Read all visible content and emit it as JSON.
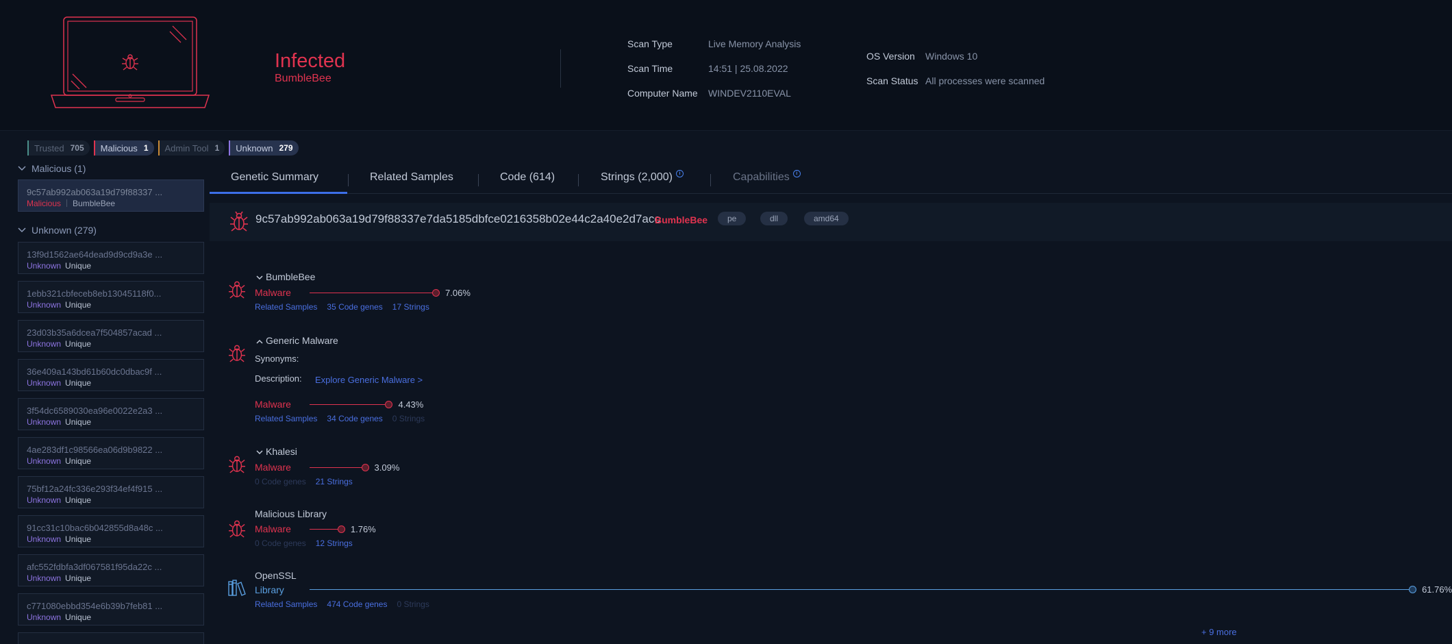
{
  "header": {
    "status_title": "Infected",
    "status_family": "BumbleBee",
    "scan_type_label": "Scan Type",
    "scan_type_value": "Live Memory Analysis",
    "scan_time_label": "Scan Time",
    "scan_time_value": "14:51 | 25.08.2022",
    "computer_name_label": "Computer Name",
    "computer_name_value": "WINDEV2110EVAL",
    "os_version_label": "OS Version",
    "os_version_value": "Windows 10",
    "scan_status_label": "Scan Status",
    "scan_status_value": "All processes were scanned"
  },
  "filters": [
    {
      "label": "Trusted",
      "count": "705"
    },
    {
      "label": "Malicious",
      "count": "1"
    },
    {
      "label": "Admin Tool",
      "count": "1"
    },
    {
      "label": "Unknown",
      "count": "279"
    }
  ],
  "sidebar": {
    "malicious_group": "Malicious (1)",
    "unknown_group": "Unknown (279)",
    "malicious_items": [
      {
        "hash": "9c57ab992ab063a19d79f88337 ...",
        "verdict": "Malicious",
        "family": "BumbleBee"
      }
    ],
    "unknown_items": [
      {
        "hash": "13f9d1562ae64dead9d9cd9a3e ...",
        "verdict": "Unknown",
        "tag": "Unique"
      },
      {
        "hash": "1ebb321cbfeceb8eb13045118f0...",
        "verdict": "Unknown",
        "tag": "Unique"
      },
      {
        "hash": "23d03b35a6dcea7f504857acad ...",
        "verdict": "Unknown",
        "tag": "Unique"
      },
      {
        "hash": "36e409a143bd61b60dc0dbac9f ...",
        "verdict": "Unknown",
        "tag": "Unique"
      },
      {
        "hash": "3f54dc6589030ea96e0022e2a3 ...",
        "verdict": "Unknown",
        "tag": "Unique"
      },
      {
        "hash": "4ae283df1c98566ea06d9b9822 ...",
        "verdict": "Unknown",
        "tag": "Unique"
      },
      {
        "hash": "75bf12a24fc336e293f34ef4f915 ...",
        "verdict": "Unknown",
        "tag": "Unique"
      },
      {
        "hash": "91cc31c10bac6b042855d8a48c ...",
        "verdict": "Unknown",
        "tag": "Unique"
      },
      {
        "hash": "afc552fdbfa3df067581f95da22c ...",
        "verdict": "Unknown",
        "tag": "Unique"
      },
      {
        "hash": "c771080ebbd354e6b39b7feb81 ...",
        "verdict": "Unknown",
        "tag": "Unique"
      }
    ]
  },
  "tabs": {
    "genetic_summary": "Genetic Summary",
    "related_samples": "Related Samples",
    "code": "Code (614)",
    "strings": "Strings (2,000)",
    "capabilities": "Capabilities"
  },
  "file": {
    "hash": "9c57ab992ab063a19d79f88337e7da5185dbfce0216358b02e44c2a40e2d7acc",
    "family": "BumbleBee",
    "tags": [
      "pe",
      "dll",
      "amd64"
    ]
  },
  "genes": [
    {
      "name": "BumbleBee",
      "type": "Malware",
      "percent": "7.06%",
      "value": 7.06,
      "links": [
        "Related Samples",
        "35 Code genes",
        "17 Strings"
      ]
    },
    {
      "name": "Generic Malware",
      "type": "Malware",
      "percent": "4.43%",
      "value": 4.43,
      "synonyms_label": "Synonyms:",
      "description_label": "Description:",
      "description_link": "Explore Generic Malware >",
      "links": [
        "Related Samples",
        "34 Code genes",
        "0 Strings"
      ]
    },
    {
      "name": "Khalesi",
      "type": "Malware",
      "percent": "3.09%",
      "value": 3.09,
      "links": [
        "0 Code genes",
        "21 Strings"
      ]
    },
    {
      "name": "Malicious Library",
      "type": "Malware",
      "percent": "1.76%",
      "value": 1.76,
      "links": [
        "0 Code genes",
        "12 Strings"
      ]
    },
    {
      "name": "OpenSSL",
      "type": "Library",
      "percent": "61.76%",
      "value": 61.76,
      "links": [
        "Related Samples",
        "474 Code genes",
        "0 Strings"
      ]
    }
  ],
  "more_link": "+ 9 more",
  "colors": {
    "malware": "#e0334f",
    "library": "#5a9fe0",
    "accent": "#3d6fe8",
    "unknown": "#8c73e0"
  }
}
